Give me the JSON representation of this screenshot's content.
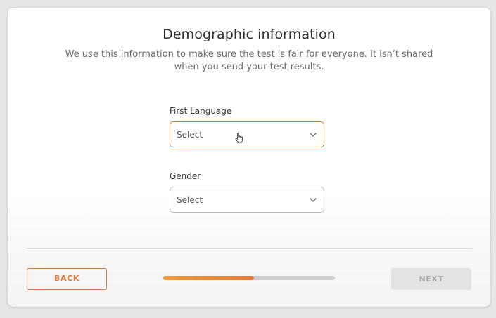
{
  "page": {
    "title": "Demographic information",
    "subtitle": "We use this information to make sure the test is fair for everyone. It isn’t shared when you send your test results."
  },
  "fields": {
    "first_language": {
      "label": "First Language",
      "value": "Select",
      "focused": true
    },
    "gender": {
      "label": "Gender",
      "value": "Select",
      "focused": false
    }
  },
  "footer": {
    "back_label": "BACK",
    "next_label": "NEXT",
    "next_enabled": false,
    "progress_fraction": 0.53
  },
  "colors": {
    "accent": "#e07b3c",
    "progress_start": "#ec9a3a",
    "progress_track": "#cfcfcf",
    "disabled_bg": "#e3e3e3",
    "disabled_text": "#a9a9a9"
  },
  "icons": {
    "select_arrow": "chevron-down-icon",
    "pointer": "hand-cursor-icon"
  }
}
